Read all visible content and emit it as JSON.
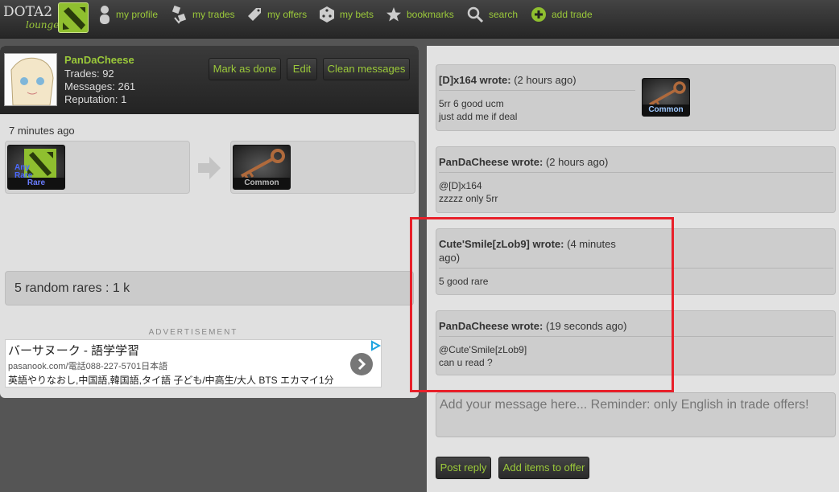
{
  "nav": {
    "logo_main": "DOTA2",
    "logo_sub": "lounge",
    "items": [
      {
        "label": "my profile",
        "icon": "person-icon"
      },
      {
        "label": "my trades",
        "icon": "trades-icon"
      },
      {
        "label": "my offers",
        "icon": "tag-icon"
      },
      {
        "label": "my bets",
        "icon": "dice-icon"
      },
      {
        "label": "bookmarks",
        "icon": "star-icon"
      },
      {
        "label": "search",
        "icon": "search-icon"
      },
      {
        "label": "add trade",
        "icon": "plus-icon"
      }
    ]
  },
  "trade": {
    "user": {
      "name": "PanDaCheese",
      "trades": "Trades: 92",
      "messages": "Messages: 261",
      "reputation": "Reputation: 1"
    },
    "buttons": {
      "done": "Mark as done",
      "edit": "Edit",
      "clean": "Clean messages"
    },
    "time_ago": "7 minutes ago",
    "offer_item": {
      "top_text": "Any",
      "top_text2": "Rare",
      "rarity": "Rare"
    },
    "want_item": {
      "rarity": "Common"
    },
    "notes": "5 random rares : 1 k"
  },
  "ad": {
    "label": "ADVERTISEMENT",
    "title": "バーサヌーク - 語学学習",
    "url": "pasanook.com/電話088-227-5701日本語",
    "desc": "英語やりなおし,中国語,韓国語,タイ語 子ども/中高生/大人 BTS エカマイ1分"
  },
  "messages": [
    {
      "author": "[D]x164 wrote:",
      "time": "(2 hours ago)",
      "lines": [
        "5rr 6 good ucm",
        "just add me if deal"
      ],
      "item": "Common"
    },
    {
      "author": "PanDaCheese wrote:",
      "time": "(2 hours ago)",
      "lines": [
        "@[D]x164",
        "zzzzz only 5rr"
      ]
    },
    {
      "author": "Cute'Smile[zLob9] wrote:",
      "time": "(4 minutes",
      "time2": "ago)",
      "lines": [
        "5 good rare"
      ]
    },
    {
      "author": "PanDaCheese wrote:",
      "time": "(19 seconds ago)",
      "lines": [
        "@Cute'Smile[zLob9]",
        "can u read ?"
      ]
    }
  ],
  "reply": {
    "placeholder": "Add your message here... Reminder: only English in trade offers!",
    "post": "Post reply",
    "add_items": "Add items to offer"
  },
  "colors": {
    "accent": "#9bc93a",
    "highlight": "#e8202a"
  }
}
